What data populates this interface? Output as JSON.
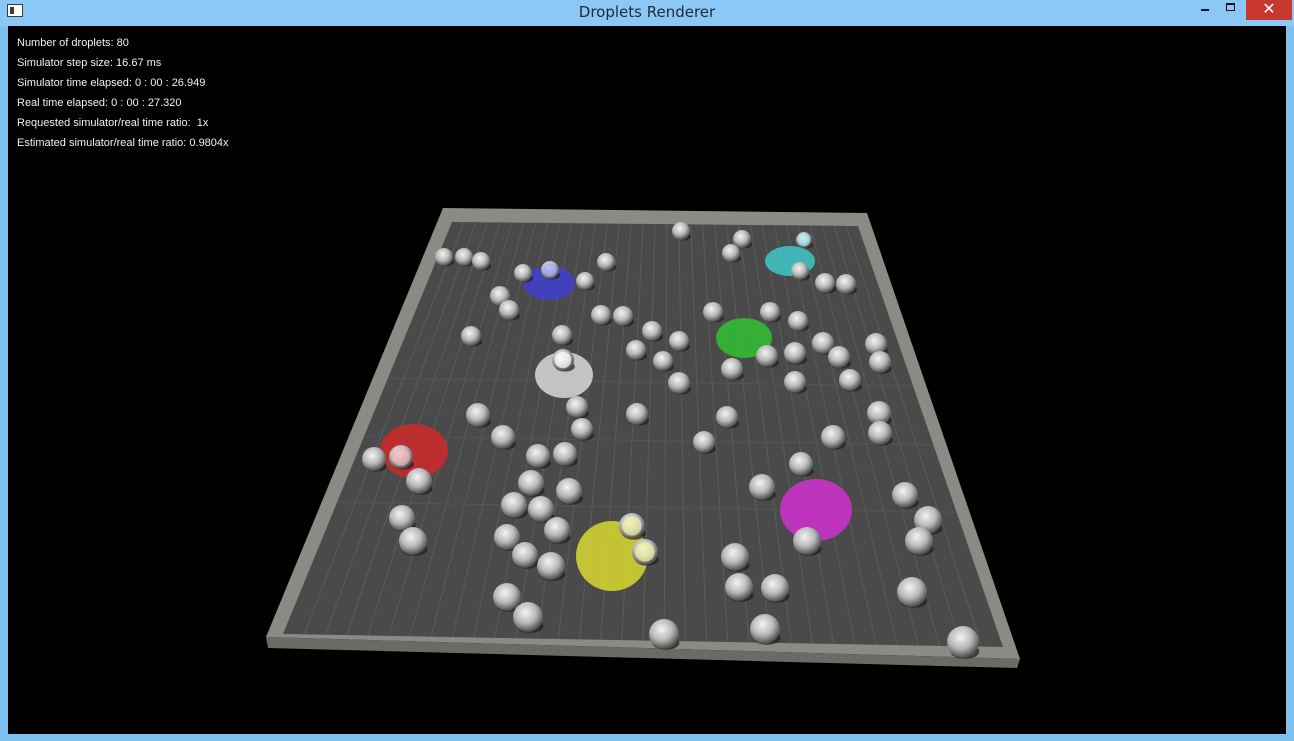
{
  "window": {
    "title": "Droplets Renderer",
    "close_glyph": "✕"
  },
  "hud": [
    {
      "label": "Number of droplets: ",
      "value": "80"
    },
    {
      "label": "Simulator step size: ",
      "value": "16.67 ms"
    },
    {
      "label": "Simulator time elapsed: ",
      "value": "0 : 00 : 26.949"
    },
    {
      "label": "Real time elapsed: ",
      "value": "0 : 00 : 27.320"
    },
    {
      "label": "Requested simulator/real time ratio:  ",
      "value": "1x"
    },
    {
      "label": "Estimated simulator/real time ratio: ",
      "value": "0.9804x"
    }
  ],
  "colors": {
    "floor": "#4a4a4a",
    "wall": "#8b8b86",
    "droplet": "#c8c8c8",
    "blue_zone": "#4040d0",
    "cyan_zone": "#40c8c8",
    "green_zone": "#30c030",
    "white_zone": "#d8d8d8",
    "red_zone": "#d02828",
    "magenta_zone": "#d030d0",
    "yellow_zone": "#d8d830"
  }
}
